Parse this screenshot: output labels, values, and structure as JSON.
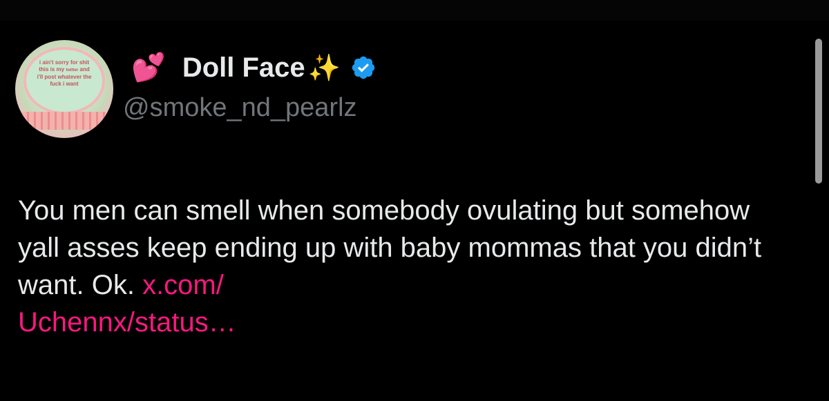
{
  "user": {
    "display_name": "Doll Face",
    "handle": "@smoke_nd_pearlz",
    "emoji_prefix": "💕",
    "emoji_suffix": "✨",
    "verified": true,
    "verified_color": "#1d9bf0",
    "avatar": {
      "line1": "i ain't sorry for shit",
      "line2a": "this is my ",
      "line2b": "twitter",
      "line2c": " and",
      "line3": "i'll post whatever the",
      "line4": "fuck i want"
    }
  },
  "tweet": {
    "text": "You men can smell when somebody ovulating but somehow yall asses keep ending up with baby mommas that you didn’t want. Ok. ",
    "link_text": "x.com/\nUchennx/status…",
    "link_color": "#f91880"
  },
  "colors": {
    "background": "#000000",
    "text": "#e7e9ea",
    "secondary_text": "#71767b"
  }
}
